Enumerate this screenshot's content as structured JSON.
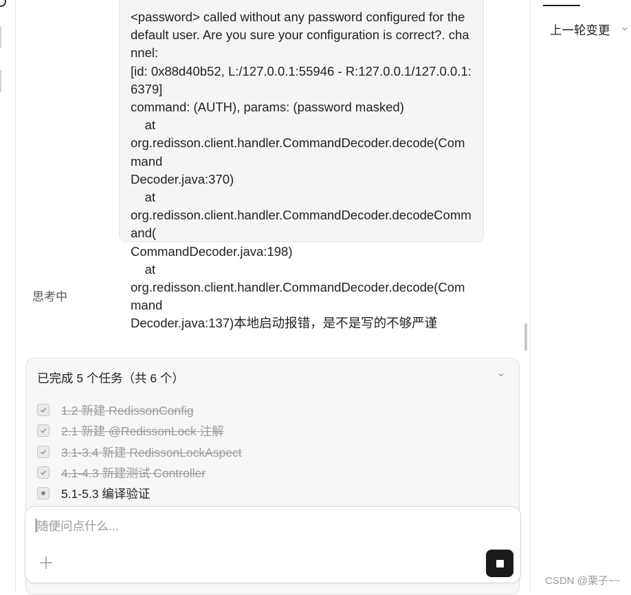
{
  "conversation": {
    "message_lines": [
      "<password> called without any password configured for the",
      "default user. Are you sure your configuration is correct?. channel:",
      "[id: 0x88d40b52, L:/127.0.0.1:55946 - R:127.0.0.1/127.0.0.1:6379]",
      "command: (AUTH), params: (password masked)",
      "    at",
      "org.redisson.client.handler.CommandDecoder.decode(Command",
      "Decoder.java:370)",
      "    at",
      "org.redisson.client.handler.CommandDecoder.decodeCommand(",
      "CommandDecoder.java:198)",
      "    at",
      "org.redisson.client.handler.CommandDecoder.decode(Command",
      "Decoder.java:137)本地启动报错，是不是写的不够严谨"
    ],
    "thinking_label": "思考中"
  },
  "task_panel": {
    "header": "已完成 5 个任务（共 6 个）",
    "tasks": [
      {
        "label": "1.2 新建 RedissonConfig",
        "status": "done"
      },
      {
        "label": "2.1 新建 @RedissonLock 注解",
        "status": "done"
      },
      {
        "label": "3.1-3.4 新建 RedissonLockAspect",
        "status": "done"
      },
      {
        "label": "4.1-4.3 新建测试 Controller",
        "status": "done"
      },
      {
        "label": "5.1-5.3 编译验证",
        "status": "in-progress"
      }
    ]
  },
  "composer": {
    "placeholder": "随便问点什么..."
  },
  "right_panel": {
    "title": "上一轮变更"
  },
  "watermark": "CSDN @栗子~~"
}
